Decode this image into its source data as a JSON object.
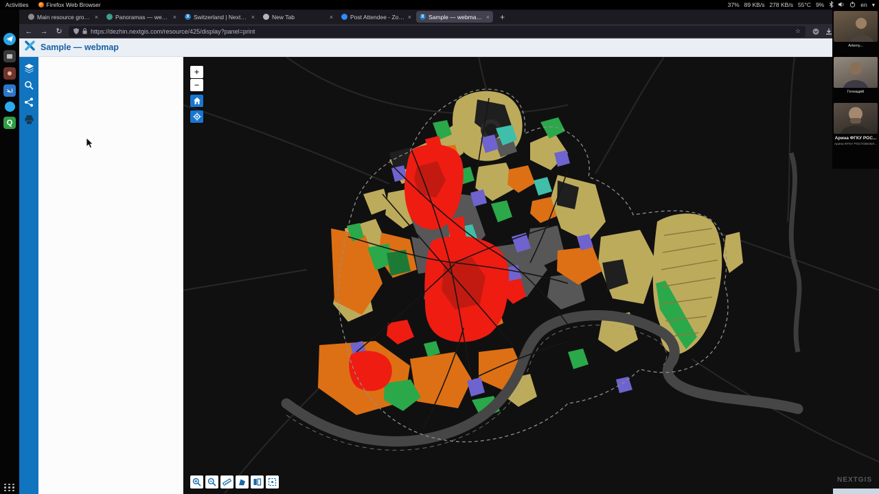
{
  "glyphs": {
    "close": "×",
    "new_tab": "+",
    "back": "←",
    "forward": "→",
    "reload": "↻",
    "star": "☆",
    "chevron": "▾",
    "zoom_in": "+",
    "zoom_out": "−"
  },
  "topbar": {
    "activities": "Activities",
    "window_title": "Firefox Web Browser",
    "cpu": "37%",
    "down": "89 KB/s",
    "up": "278 KB/s",
    "temp": "55°C",
    "mem": "9%",
    "lang": "en"
  },
  "tabs": [
    {
      "title": "Main resource group |"
    },
    {
      "title": "Panoramas — webmap"
    },
    {
      "title": "Switzerland | NextGIS"
    },
    {
      "title": "New Tab"
    },
    {
      "title": "Post Attendee - Zoom"
    },
    {
      "title": "Sample — webmap | S"
    }
  ],
  "navbar": {
    "url": "https://dezhin.nextgis.com/resource/425/display?panel=print"
  },
  "webmap": {
    "title": "Sample — webmap",
    "watermark": "NEXTGIS"
  },
  "zoom_call": {
    "caption1": "Artemy...",
    "caption2": "Геннадий",
    "caption3": "Арина ФГКУ РОС...",
    "caption4": "Арина ФГКУ РОСТОВОБЛ..."
  },
  "map_colors": {
    "background": "#101010",
    "residential_red": "#ef1c12",
    "industrial_orange": "#dd7014",
    "fields_khaki": "#bdab5c",
    "greenery": "#2ba84a",
    "water_teal": "#3fbfa9",
    "public_purple": "#6f63cf",
    "built_gray": "#575757",
    "river": "#464646"
  }
}
